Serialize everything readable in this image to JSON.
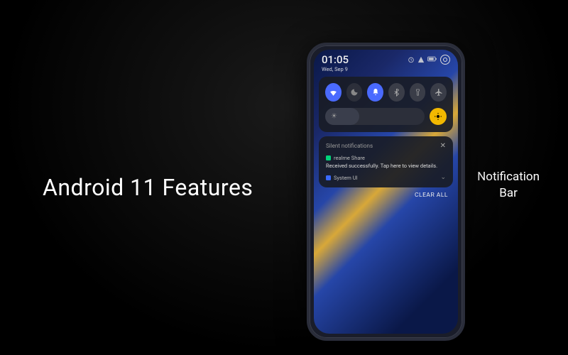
{
  "slide": {
    "title": "Android 11 Features",
    "subtitle_line1": "Notification",
    "subtitle_line2": "Bar"
  },
  "statusbar": {
    "time": "01:05",
    "date": "Wed, Sep 9"
  },
  "quick_settings": {
    "tiles": [
      {
        "name": "wifi",
        "active": true
      },
      {
        "name": "dark-mode",
        "active": false
      },
      {
        "name": "sound",
        "active": true
      },
      {
        "name": "bluetooth",
        "active": false
      },
      {
        "name": "flashlight",
        "active": false
      },
      {
        "name": "airplane",
        "active": false
      }
    ],
    "brightness_pct": 34
  },
  "notifications": {
    "section_label": "Silent notifications",
    "items": [
      {
        "app": "realme Share",
        "body": "Received successfully. Tap here to view details.",
        "icon_color": "green"
      },
      {
        "app": "System UI",
        "body": "",
        "icon_color": "blue"
      }
    ],
    "clear_label": "CLEAR ALL"
  }
}
